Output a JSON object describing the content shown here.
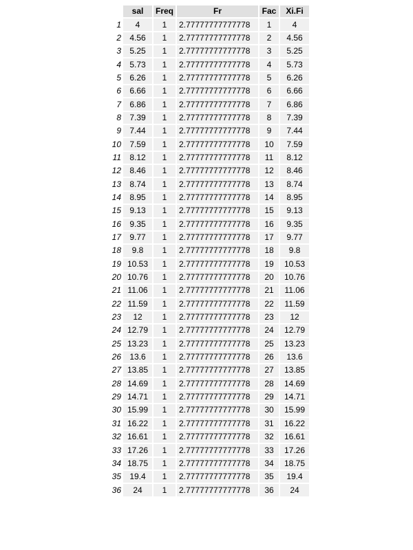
{
  "table": {
    "columns": {
      "rownum": "",
      "sal": "sal",
      "freq": "Freq",
      "fr": "Fr",
      "fac": "Fac",
      "xifi": "Xi.Fi"
    },
    "rows": [
      {
        "rn": "1",
        "sal": "4",
        "freq": "1",
        "fr": "2.77777777777778",
        "fac": "1",
        "xifi": "4"
      },
      {
        "rn": "2",
        "sal": "4.56",
        "freq": "1",
        "fr": "2.77777777777778",
        "fac": "2",
        "xifi": "4.56"
      },
      {
        "rn": "3",
        "sal": "5.25",
        "freq": "1",
        "fr": "2.77777777777778",
        "fac": "3",
        "xifi": "5.25"
      },
      {
        "rn": "4",
        "sal": "5.73",
        "freq": "1",
        "fr": "2.77777777777778",
        "fac": "4",
        "xifi": "5.73"
      },
      {
        "rn": "5",
        "sal": "6.26",
        "freq": "1",
        "fr": "2.77777777777778",
        "fac": "5",
        "xifi": "6.26"
      },
      {
        "rn": "6",
        "sal": "6.66",
        "freq": "1",
        "fr": "2.77777777777778",
        "fac": "6",
        "xifi": "6.66"
      },
      {
        "rn": "7",
        "sal": "6.86",
        "freq": "1",
        "fr": "2.77777777777778",
        "fac": "7",
        "xifi": "6.86"
      },
      {
        "rn": "8",
        "sal": "7.39",
        "freq": "1",
        "fr": "2.77777777777778",
        "fac": "8",
        "xifi": "7.39"
      },
      {
        "rn": "9",
        "sal": "7.44",
        "freq": "1",
        "fr": "2.77777777777778",
        "fac": "9",
        "xifi": "7.44"
      },
      {
        "rn": "10",
        "sal": "7.59",
        "freq": "1",
        "fr": "2.77777777777778",
        "fac": "10",
        "xifi": "7.59"
      },
      {
        "rn": "11",
        "sal": "8.12",
        "freq": "1",
        "fr": "2.77777777777778",
        "fac": "11",
        "xifi": "8.12"
      },
      {
        "rn": "12",
        "sal": "8.46",
        "freq": "1",
        "fr": "2.77777777777778",
        "fac": "12",
        "xifi": "8.46"
      },
      {
        "rn": "13",
        "sal": "8.74",
        "freq": "1",
        "fr": "2.77777777777778",
        "fac": "13",
        "xifi": "8.74"
      },
      {
        "rn": "14",
        "sal": "8.95",
        "freq": "1",
        "fr": "2.77777777777778",
        "fac": "14",
        "xifi": "8.95"
      },
      {
        "rn": "15",
        "sal": "9.13",
        "freq": "1",
        "fr": "2.77777777777778",
        "fac": "15",
        "xifi": "9.13"
      },
      {
        "rn": "16",
        "sal": "9.35",
        "freq": "1",
        "fr": "2.77777777777778",
        "fac": "16",
        "xifi": "9.35"
      },
      {
        "rn": "17",
        "sal": "9.77",
        "freq": "1",
        "fr": "2.77777777777778",
        "fac": "17",
        "xifi": "9.77"
      },
      {
        "rn": "18",
        "sal": "9.8",
        "freq": "1",
        "fr": "2.77777777777778",
        "fac": "18",
        "xifi": "9.8"
      },
      {
        "rn": "19",
        "sal": "10.53",
        "freq": "1",
        "fr": "2.77777777777778",
        "fac": "19",
        "xifi": "10.53"
      },
      {
        "rn": "20",
        "sal": "10.76",
        "freq": "1",
        "fr": "2.77777777777778",
        "fac": "20",
        "xifi": "10.76"
      },
      {
        "rn": "21",
        "sal": "11.06",
        "freq": "1",
        "fr": "2.77777777777778",
        "fac": "21",
        "xifi": "11.06"
      },
      {
        "rn": "22",
        "sal": "11.59",
        "freq": "1",
        "fr": "2.77777777777778",
        "fac": "22",
        "xifi": "11.59"
      },
      {
        "rn": "23",
        "sal": "12",
        "freq": "1",
        "fr": "2.77777777777778",
        "fac": "23",
        "xifi": "12"
      },
      {
        "rn": "24",
        "sal": "12.79",
        "freq": "1",
        "fr": "2.77777777777778",
        "fac": "24",
        "xifi": "12.79"
      },
      {
        "rn": "25",
        "sal": "13.23",
        "freq": "1",
        "fr": "2.77777777777778",
        "fac": "25",
        "xifi": "13.23"
      },
      {
        "rn": "26",
        "sal": "13.6",
        "freq": "1",
        "fr": "2.77777777777778",
        "fac": "26",
        "xifi": "13.6"
      },
      {
        "rn": "27",
        "sal": "13.85",
        "freq": "1",
        "fr": "2.77777777777778",
        "fac": "27",
        "xifi": "13.85"
      },
      {
        "rn": "28",
        "sal": "14.69",
        "freq": "1",
        "fr": "2.77777777777778",
        "fac": "28",
        "xifi": "14.69"
      },
      {
        "rn": "29",
        "sal": "14.71",
        "freq": "1",
        "fr": "2.77777777777778",
        "fac": "29",
        "xifi": "14.71"
      },
      {
        "rn": "30",
        "sal": "15.99",
        "freq": "1",
        "fr": "2.77777777777778",
        "fac": "30",
        "xifi": "15.99"
      },
      {
        "rn": "31",
        "sal": "16.22",
        "freq": "1",
        "fr": "2.77777777777778",
        "fac": "31",
        "xifi": "16.22"
      },
      {
        "rn": "32",
        "sal": "16.61",
        "freq": "1",
        "fr": "2.77777777777778",
        "fac": "32",
        "xifi": "16.61"
      },
      {
        "rn": "33",
        "sal": "17.26",
        "freq": "1",
        "fr": "2.77777777777778",
        "fac": "33",
        "xifi": "17.26"
      },
      {
        "rn": "34",
        "sal": "18.75",
        "freq": "1",
        "fr": "2.77777777777778",
        "fac": "34",
        "xifi": "18.75"
      },
      {
        "rn": "35",
        "sal": "19.4",
        "freq": "1",
        "fr": "2.77777777777778",
        "fac": "35",
        "xifi": "19.4"
      },
      {
        "rn": "36",
        "sal": "24",
        "freq": "1",
        "fr": "2.77777777777778",
        "fac": "36",
        "xifi": "24"
      }
    ]
  }
}
